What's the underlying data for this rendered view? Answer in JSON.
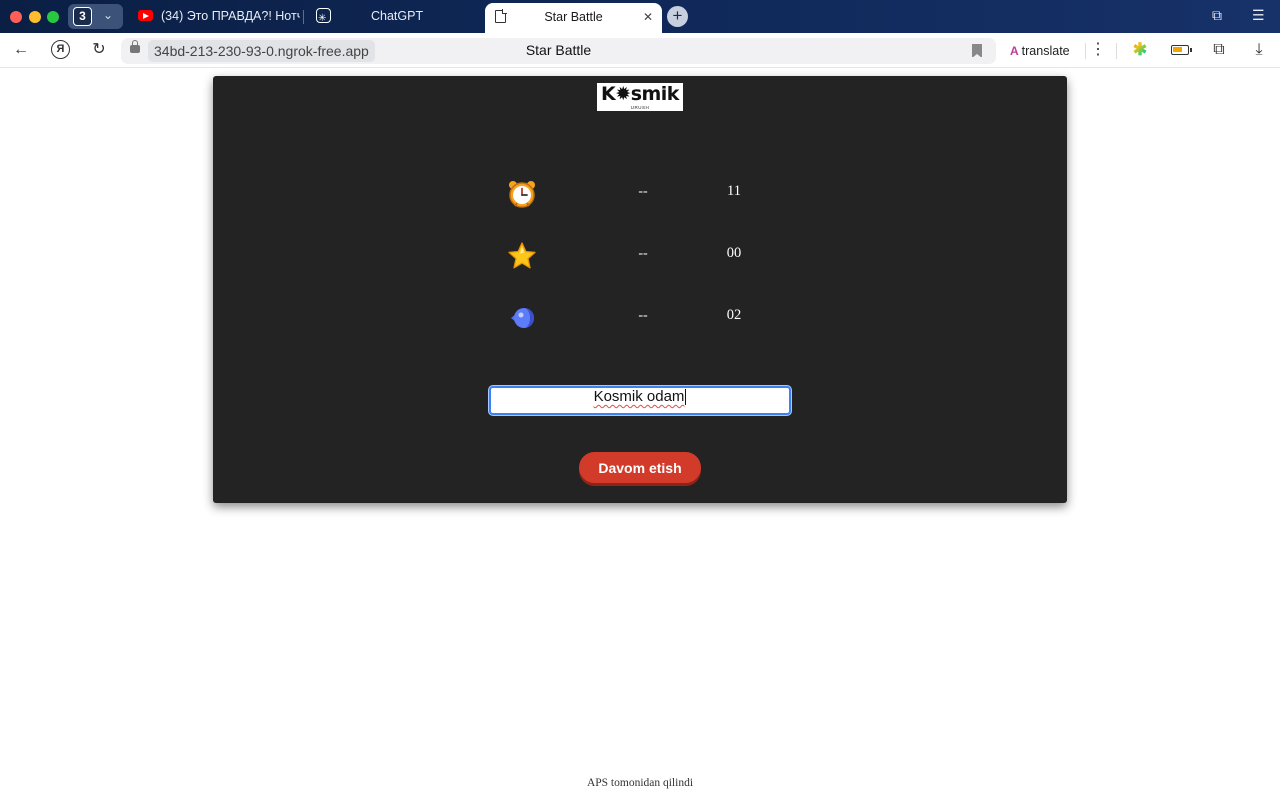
{
  "browser": {
    "tab_count": "3",
    "tabs": [
      {
        "title": "(34) Это ПРАВДА?! Нотч /",
        "icon": "youtube-icon"
      },
      {
        "title": "ChatGPT",
        "icon": "chatgpt-icon"
      },
      {
        "title": "Star Battle",
        "icon": "document-icon",
        "active": true
      }
    ],
    "url": "34bd-213-230-93-0.ngrok-free.app",
    "page_title": "Star Battle",
    "translate_label": "translate"
  },
  "game": {
    "logo_text": "K✹smik",
    "logo_subtext": "URUSH",
    "stats": [
      {
        "icon": "alarm-clock-icon",
        "left": "--",
        "value": "11"
      },
      {
        "icon": "star-icon",
        "left": "--",
        "value": "00"
      },
      {
        "icon": "rocket-ship-icon",
        "left": "--",
        "value": "02"
      }
    ],
    "name_input_value": "Kosmik odam",
    "continue_label": "Davom etish"
  },
  "footer": {
    "text": "APS tomonidan qilindi"
  },
  "colors": {
    "card_bg": "#232323",
    "button_red": "#d23b2a",
    "input_focus": "#3a82f6"
  }
}
